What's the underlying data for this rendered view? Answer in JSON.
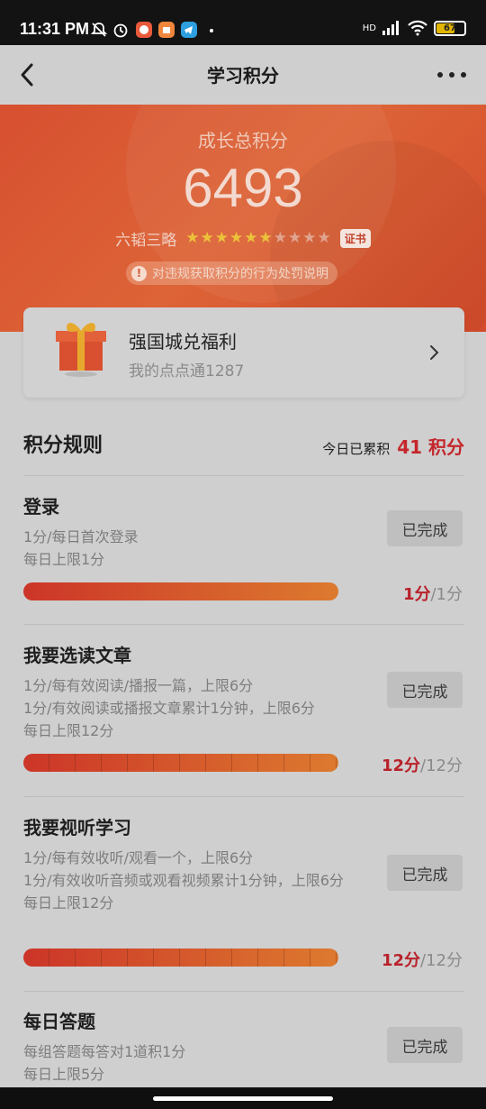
{
  "status": {
    "time": "11:31 PM",
    "battery": "67",
    "network": "HD"
  },
  "header": {
    "title": "学习积分"
  },
  "hero": {
    "label": "成长总积分",
    "total": "6493",
    "rank": "六韬三略",
    "stars_total": 10,
    "stars_filled": 6,
    "cert_label": "证书",
    "notice": "对违规获取积分的行为处罚说明"
  },
  "welfare": {
    "title": "强国城兑福利",
    "subtitle": "我的点点通1287"
  },
  "rules_section": {
    "title": "积分规则",
    "today_label": "今日已累积",
    "today_value": "41 积分"
  },
  "rules": [
    {
      "name": "登录",
      "desc": [
        "1分/每日首次登录",
        "每日上限1分"
      ],
      "button": "已完成",
      "got": "1分",
      "max": "/1分",
      "progress": 1.0,
      "ticks": false
    },
    {
      "name": "我要选读文章",
      "desc": [
        "1分/每有效阅读/播报一篇，上限6分",
        "1分/有效阅读或播报文章累计1分钟，上限6分",
        "每日上限12分"
      ],
      "button": "已完成",
      "got": "12分",
      "max": "/12分",
      "progress": 1.0,
      "ticks": true
    },
    {
      "name": "我要视听学习",
      "desc": [
        "1分/每有效收听/观看一个，上限6分",
        "1分/有效收听音频或观看视频累计1分钟，上限6分",
        "每日上限12分"
      ],
      "button": "已完成",
      "got": "12分",
      "max": "/12分",
      "progress": 1.0,
      "ticks": true
    },
    {
      "name": "每日答题",
      "desc": [
        "每组答题每答对1道积1分",
        "每日上限5分"
      ],
      "button": "已完成",
      "got": "",
      "max": "",
      "progress": null,
      "ticks": false
    }
  ],
  "colors": {
    "accent": "#c4262b",
    "hero": "#d75030",
    "bar_start": "#cc3528",
    "bar_end": "#dd7a2f"
  }
}
